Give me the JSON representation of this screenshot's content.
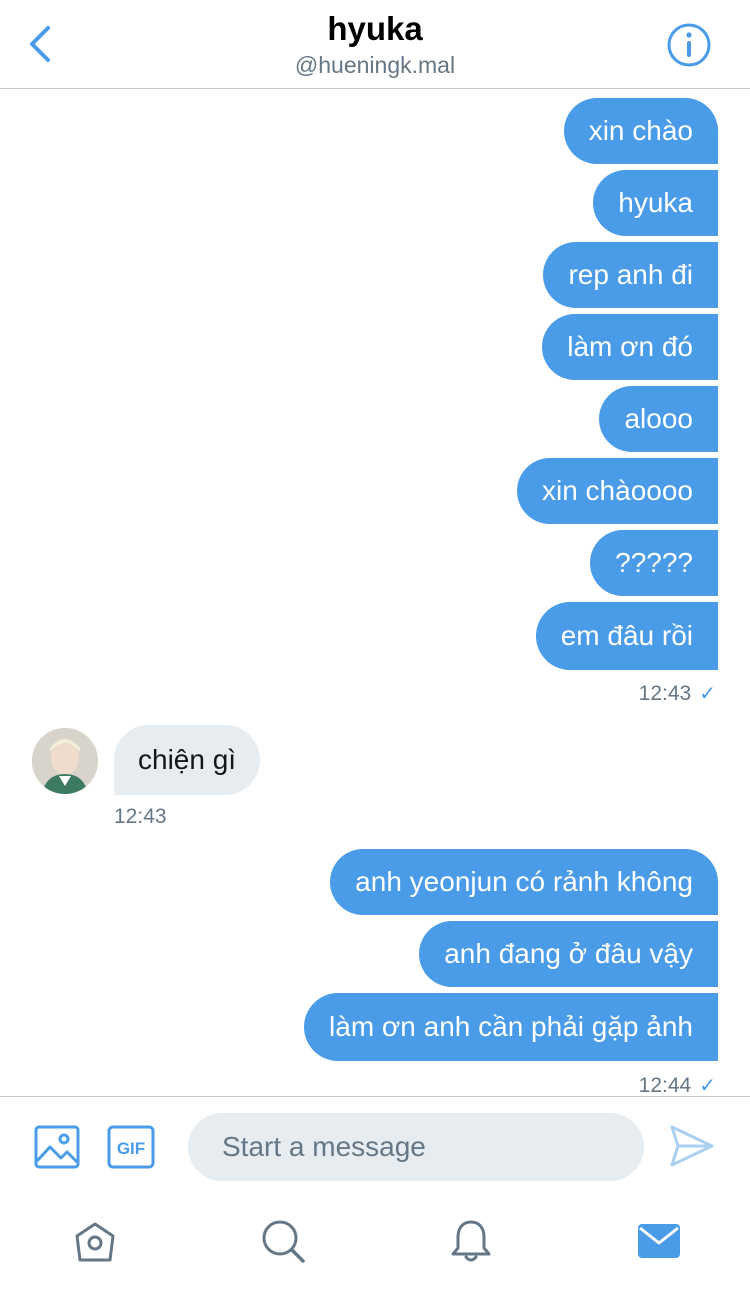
{
  "header": {
    "name": "hyuka",
    "handle": "@hueningk.mal"
  },
  "messages": {
    "group1": [
      "xin chào",
      "hyuka",
      "rep anh đi",
      "làm ơn đó",
      "alooo",
      "xin chàoooo",
      "?????",
      "em đâu rồi"
    ],
    "group1_time": "12:43",
    "received": "chiện gì",
    "received_time": "12:43",
    "group2": [
      "anh yeonjun có rảnh không",
      "anh đang ở đâu vậy",
      "làm ơn anh cần phải gặp ảnh"
    ],
    "group2_time": "12:44",
    "read_mark": "✓"
  },
  "composer": {
    "placeholder": "Start a message",
    "gif_label": "GIF"
  },
  "colors": {
    "accent": "#4a9be8",
    "received_bubble": "#e6ecf0",
    "muted": "#657786"
  },
  "icons": [
    "back-chevron-icon",
    "info-icon",
    "image-icon",
    "gif-icon",
    "send-icon",
    "home-icon",
    "search-icon",
    "notifications-icon",
    "messages-icon"
  ]
}
